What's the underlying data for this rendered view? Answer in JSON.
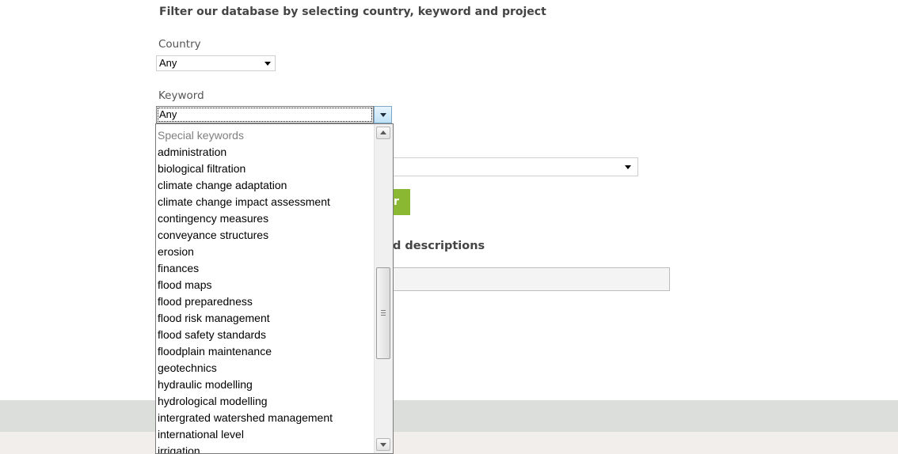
{
  "form": {
    "heading": "Filter our database by selecting country, keyword and project",
    "country": {
      "label": "Country",
      "value": "Any"
    },
    "keyword": {
      "label": "Keyword",
      "value": "Any"
    },
    "project": {
      "value": ""
    },
    "search_section": {
      "heading_partial": "d descriptions",
      "input_value": ""
    },
    "submit_button": {
      "label": "r",
      "color": "#8ab832"
    }
  },
  "keyword_dropdown": {
    "items": [
      {
        "label": "Special keywords",
        "group": true
      },
      {
        "label": "administration"
      },
      {
        "label": "biological filtration"
      },
      {
        "label": "climate change adaptation"
      },
      {
        "label": "climate change impact assessment"
      },
      {
        "label": "contingency measures"
      },
      {
        "label": "conveyance structures"
      },
      {
        "label": "erosion"
      },
      {
        "label": "finances"
      },
      {
        "label": "flood maps"
      },
      {
        "label": "flood preparedness"
      },
      {
        "label": "flood risk management"
      },
      {
        "label": "flood safety standards"
      },
      {
        "label": "floodplain maintenance"
      },
      {
        "label": "geotechnics"
      },
      {
        "label": "hydraulic modelling"
      },
      {
        "label": "hydrological modelling"
      },
      {
        "label": "intergrated watershed management"
      },
      {
        "label": "international level"
      },
      {
        "label": "irrigation"
      }
    ]
  },
  "footer": {
    "band_color": "#dcdedc",
    "base_color": "#f1eeeb"
  }
}
